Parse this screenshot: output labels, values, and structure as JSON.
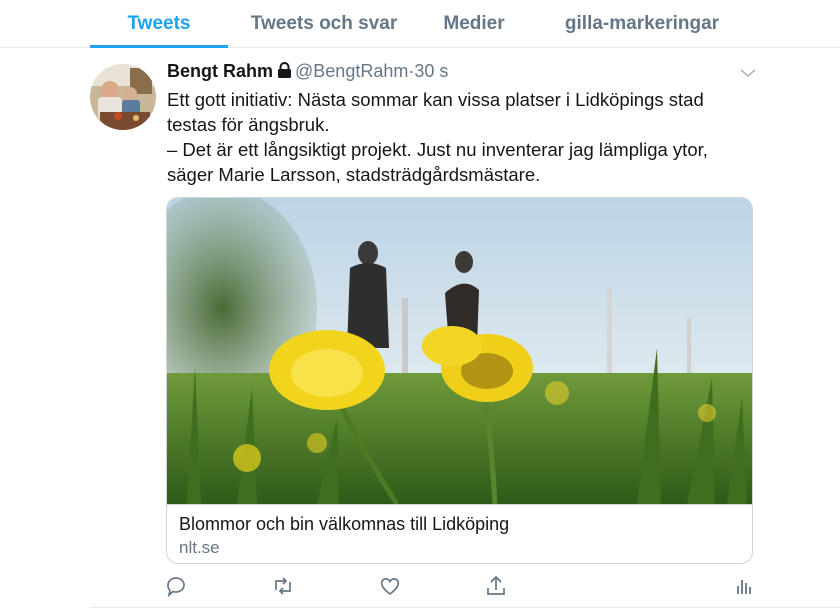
{
  "tabs": [
    {
      "label": "Tweets",
      "active": true
    },
    {
      "label": "Tweets och svar",
      "active": false
    },
    {
      "label": "Medier",
      "active": false
    },
    {
      "label": "gilla-markeringar",
      "active": false
    }
  ],
  "tweet": {
    "author_name": "Bengt Rahm",
    "author_handle": "@BengtRahm",
    "separator": "·",
    "time": "30 s",
    "protected_icon": "lock-icon",
    "text_lines": [
      "Ett gott initiativ: Nästa sommar kan vissa platser i Lidköpings stad",
      "testas för ängsbruk.",
      "– Det är ett långsiktigt projekt. Just nu inventerar jag lämpliga ytor,",
      "säger Marie Larsson, stadsträdgårdsmästare."
    ],
    "card": {
      "title": "Blommor och bin välkomnas till Lidköping",
      "domain": "nlt.se"
    },
    "actions": [
      "reply-icon",
      "retweet-icon",
      "like-icon",
      "share-icon",
      "analytics-icon"
    ]
  },
  "colors": {
    "accent": "#1da1f2",
    "muted": "#657786",
    "text": "#14171a",
    "border": "#e6ecf0"
  }
}
